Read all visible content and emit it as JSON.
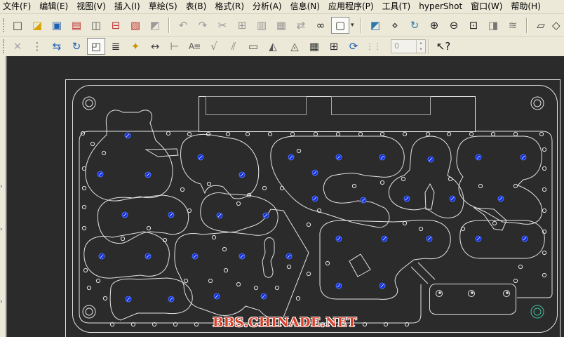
{
  "menu": [
    "文件(F)",
    "编辑(E)",
    "视图(V)",
    "插入(I)",
    "草绘(S)",
    "表(B)",
    "格式(R)",
    "分析(A)",
    "信息(N)",
    "应用程序(P)",
    "工具(T)",
    "hyperShot",
    "窗口(W)",
    "帮助(H)"
  ],
  "toolbars": {
    "top": {
      "groups": [
        [
          {
            "name": "new-file-icon",
            "glyph": "□",
            "color": "#3a3a3a"
          },
          {
            "name": "open-folder-icon",
            "glyph": "◪",
            "color": "#d9a400"
          },
          {
            "name": "save-icon",
            "glyph": "▣",
            "color": "#2060b0"
          },
          {
            "name": "save-copy-icon",
            "glyph": "▤",
            "color": "#c03030"
          },
          {
            "name": "print-preview-icon",
            "glyph": "◫",
            "color": "#555555"
          },
          {
            "name": "mail-icon",
            "glyph": "⊟",
            "color": "#c03030"
          },
          {
            "name": "export-pdf-icon",
            "glyph": "▧",
            "color": "#c03030"
          },
          {
            "name": "print-icon",
            "glyph": "◩",
            "color": "#9a9a9a"
          }
        ],
        [
          {
            "name": "undo-icon",
            "glyph": "↶",
            "color": "#9a9a9a"
          },
          {
            "name": "redo-icon",
            "glyph": "↷",
            "color": "#9a9a9a"
          },
          {
            "name": "cut-icon",
            "glyph": "✂",
            "color": "#9a9a9a"
          },
          {
            "name": "copy-icon",
            "glyph": "⊞",
            "color": "#9a9a9a"
          },
          {
            "name": "paste-icon",
            "glyph": "▥",
            "color": "#9a9a9a"
          },
          {
            "name": "paste-special-icon",
            "glyph": "▦",
            "color": "#9a9a9a"
          },
          {
            "name": "regenerate-icon",
            "glyph": "⇄",
            "color": "#9a9a9a"
          },
          {
            "name": "find-binoculars-icon",
            "glyph": "∞",
            "color": "#222222"
          },
          {
            "name": "select-box-icon",
            "glyph": "▢",
            "color": "#333333",
            "pressed": true,
            "dropdown": "▾"
          }
        ],
        [
          {
            "name": "display-style-icon",
            "glyph": "◩",
            "color": "#2a7ab0"
          },
          {
            "name": "datum-display-icon",
            "glyph": "⋄",
            "color": "#333333"
          },
          {
            "name": "repaint-icon",
            "glyph": "↻",
            "color": "#2a7ab0"
          },
          {
            "name": "zoom-in-icon",
            "glyph": "⊕",
            "color": "#222222"
          },
          {
            "name": "zoom-out-icon",
            "glyph": "⊖",
            "color": "#222222"
          },
          {
            "name": "zoom-fit-icon",
            "glyph": "⊡",
            "color": "#222222"
          },
          {
            "name": "orient-icon",
            "glyph": "◨",
            "color": "#777777"
          },
          {
            "name": "layers-icon",
            "glyph": "≋",
            "color": "#777777"
          }
        ],
        [
          {
            "name": "model-view-icon",
            "glyph": "▱",
            "color": "#333333"
          },
          {
            "name": "saved-view-icon",
            "glyph": "◇",
            "color": "#333333",
            "clip": true
          }
        ]
      ]
    },
    "bottom": {
      "groups": [
        [
          {
            "name": "close-window-icon",
            "glyph": "✕",
            "color": "#aaaaaa"
          },
          {
            "name": "settings-dropdown-icon",
            "glyph": "⋮",
            "color": "#666666"
          },
          {
            "name": "refresh-icon",
            "glyph": "⇆",
            "color": "#1a5fb4"
          },
          {
            "name": "update-icon",
            "glyph": "↻",
            "color": "#1a5fb4"
          },
          {
            "name": "model-tree-icon",
            "glyph": "◰",
            "color": "#333333",
            "pressed": true
          },
          {
            "name": "list-icon",
            "glyph": "≣",
            "color": "#333333"
          },
          {
            "name": "show-annotation-icon",
            "glyph": "✦",
            "color": "#c99000"
          },
          {
            "name": "dimension-icon",
            "glyph": "↔",
            "color": "#444444"
          },
          {
            "name": "baseline-dimension-icon",
            "glyph": "⊢",
            "color": "#777777"
          },
          {
            "name": "text-note-icon",
            "glyph": "A≡",
            "color": "#555555",
            "small": true
          },
          {
            "name": "surface-finish-icon",
            "glyph": "√",
            "color": "#888888"
          },
          {
            "name": "tolerance-icon",
            "glyph": "⫽",
            "color": "#888888"
          },
          {
            "name": "dimension-box-icon",
            "glyph": "▭",
            "color": "#555555"
          },
          {
            "name": "symbol-icon",
            "glyph": "◭",
            "color": "#555555"
          }
        ],
        [
          {
            "name": "balloon-icon",
            "glyph": "◬",
            "color": "#555555"
          },
          {
            "name": "table-icon",
            "glyph": "▦",
            "color": "#333333"
          },
          {
            "name": "cross-section-icon",
            "glyph": "⊞",
            "color": "#333333"
          },
          {
            "name": "rotate-icon",
            "glyph": "⟳",
            "color": "#1a5fb4"
          },
          {
            "name": "cosmetic-icon",
            "glyph": "⋮⋮",
            "color": "#999999",
            "small": true
          }
        ]
      ],
      "help": {
        "name": "context-help-icon",
        "glyph": "↖?",
        "color": "#111111"
      }
    }
  },
  "spinner": {
    "value": "0",
    "up": "▴",
    "down": "▾"
  },
  "left_strip": [
    "›",
    "›",
    "›"
  ],
  "watermark": "BBS.CHINADE.NET",
  "theme": {
    "chrome": "#ece9d8",
    "viewport": "#2b2b2b",
    "geometry_line": "#e4e4e4",
    "locator_fill": "#1030e0",
    "watermark": "#d8402a"
  }
}
